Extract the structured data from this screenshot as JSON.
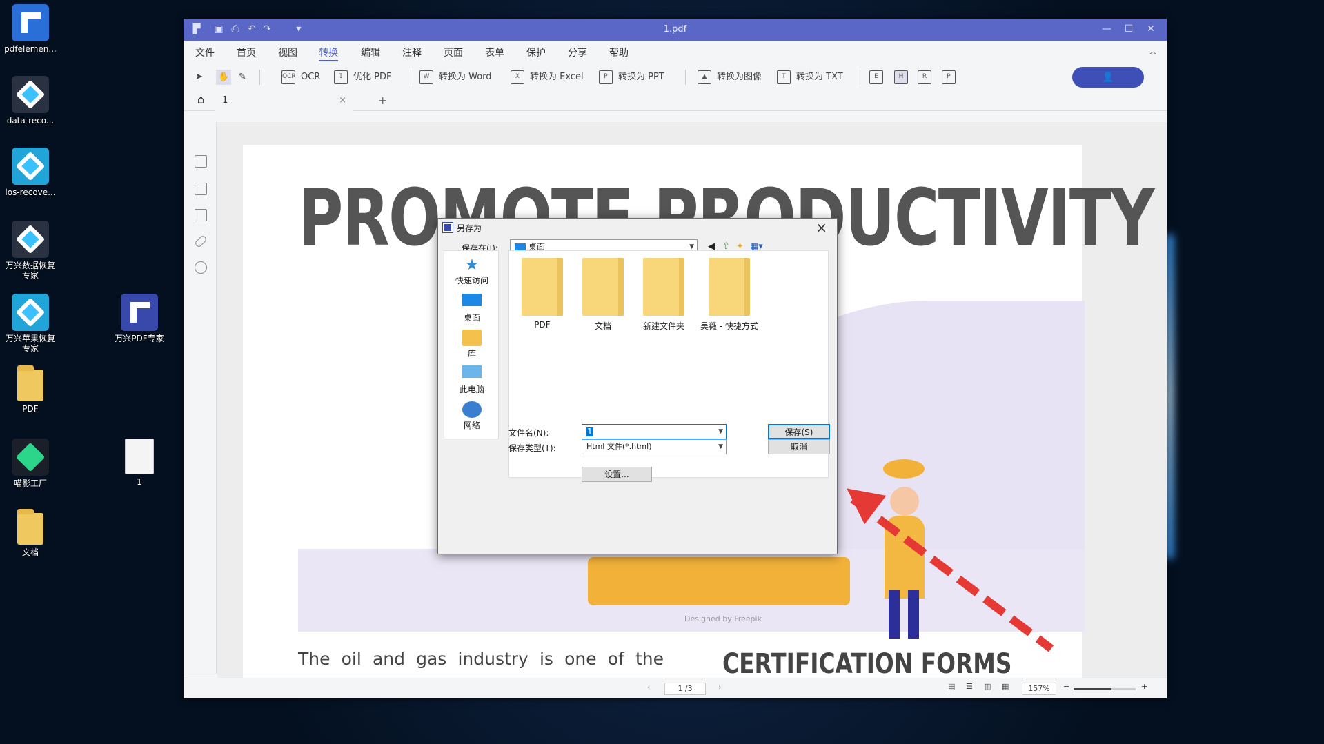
{
  "desktop": {
    "icons": [
      {
        "label": "pdfelemen..."
      },
      {
        "label": "data-reco..."
      },
      {
        "label": "ios-recove..."
      },
      {
        "label": "万兴数据恢复专家"
      },
      {
        "label": "万兴苹果恢复专家"
      },
      {
        "label": "PDF"
      },
      {
        "label": "喵影工厂"
      },
      {
        "label": "文档"
      },
      {
        "label": "万兴PDF专家"
      },
      {
        "label": "1"
      }
    ]
  },
  "window": {
    "title": "1.pdf",
    "menu": [
      "文件",
      "首页",
      "视图",
      "转换",
      "编辑",
      "注释",
      "页面",
      "表单",
      "保护",
      "分享",
      "帮助"
    ],
    "active_menu": "转换",
    "toolbar": {
      "ocr": "OCR",
      "optimize": "优化 PDF",
      "to_word": "转换为 Word",
      "to_excel": "转换为 Excel",
      "to_ppt": "转换为 PPT",
      "to_image": "转换为图像",
      "to_txt": "转换为 TXT"
    },
    "tab": {
      "label": "1",
      "close": "×",
      "add": "+"
    },
    "document": {
      "headline": "PROMOTE PRODUCTIVITY",
      "credit": "Designed by Freepik",
      "body": "The oil and gas industry is one of the more scrutinized businesses in the world. Primarily",
      "section_title": "CERTIFICATION FORMS"
    },
    "status": {
      "page": "1 /3",
      "zoom": "157%",
      "minus": "−",
      "plus": "+"
    }
  },
  "dialog": {
    "title": "另存为",
    "save_in_label": "保存在(I):",
    "location": "桌面",
    "places": [
      "快速访问",
      "桌面",
      "库",
      "此电脑",
      "网络"
    ],
    "files": [
      "PDF",
      "文档",
      "新建文件夹",
      "吴薇 - 快捷方式"
    ],
    "filename_label": "文件名(N):",
    "filename_value": "1",
    "filetype_label": "保存类型(T):",
    "filetype_value": "Html 文件(*.html)",
    "save_button": "保存(S)",
    "cancel_button": "取消",
    "settings_button": "设置..."
  },
  "colors": {
    "titlebar": "#5a67c6",
    "accent": "#4d5fd0",
    "arrow": "#e53935"
  }
}
